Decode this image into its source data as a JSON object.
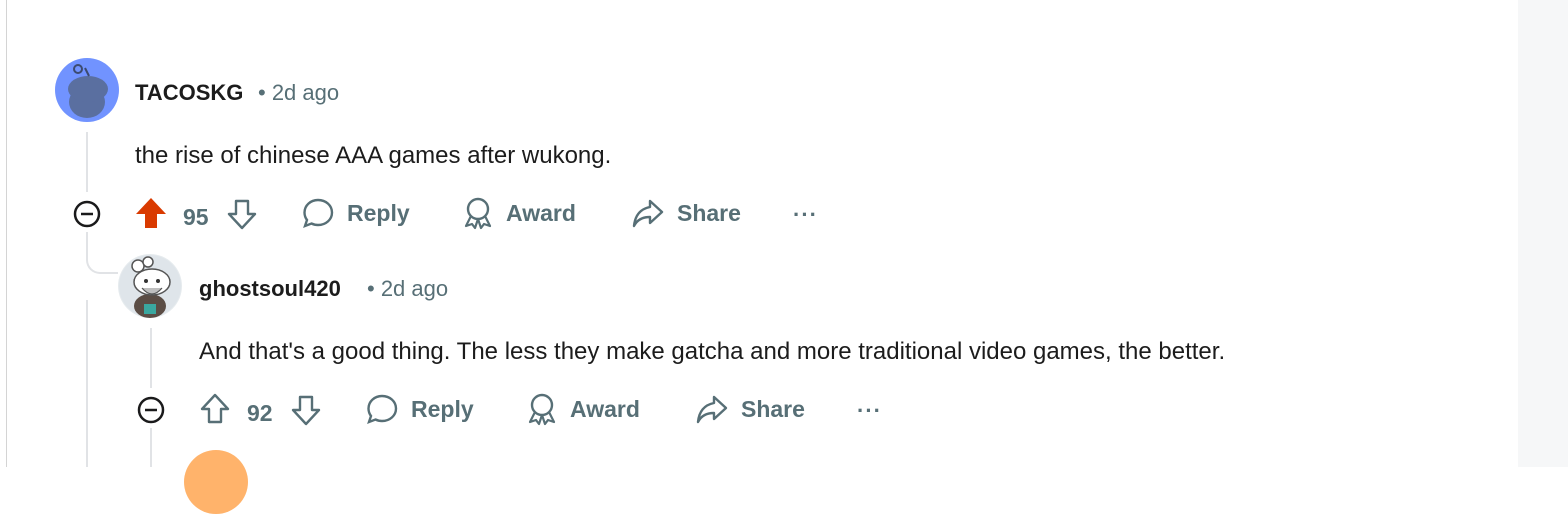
{
  "comments": [
    {
      "author": "TACOSKG",
      "time": "• 2d ago",
      "text": "the rise of chinese AAA games after wukong.",
      "votes": "95",
      "upvoted": true,
      "actions": {
        "reply": "Reply",
        "award": "Award",
        "share": "Share",
        "more": "···"
      }
    },
    {
      "author": "ghostsoul420",
      "time": "• 2d ago",
      "text": "And that's a good thing. The less they make gatcha and more traditional video games, the better.",
      "votes": "92",
      "upvoted": false,
      "actions": {
        "reply": "Reply",
        "award": "Award",
        "share": "Share",
        "more": "···"
      }
    }
  ],
  "colors": {
    "upvote_active": "#d93a00",
    "muted": "#576f76",
    "thread_line": "#e1e3e6"
  }
}
